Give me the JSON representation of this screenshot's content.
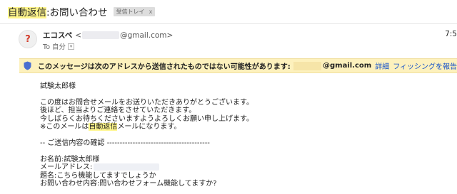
{
  "subject": {
    "highlight": "自動返信",
    "rest": ":お問い合わせ",
    "label": "受信トレイ",
    "label_close": "x"
  },
  "sender": {
    "avatar": "?",
    "name": "エコスペ",
    "lt": "<",
    "email": "@gmail.com>",
    "time": "7:5",
    "to": "To 自分",
    "to_caret": "▾"
  },
  "warning": {
    "text": "このメッセージは次のアドレスから送信されたものではない可能性があります:",
    "email": "@gmail.com",
    "details_link": "詳細",
    "report_link": "フィッシングを報告",
    "shield_color": "#4a6fd0"
  },
  "body": {
    "greeting": "試験太郎様",
    "line1": "この度はお問合せメールをお送りいただきありがとうございます。",
    "line2": "後ほど、担当よりご連絡をさせていただきます。",
    "line3": "今しばらくお待ちくださいますようよろしくお願い申し上げます。",
    "line4_pre": "※このメールは",
    "line4_hl": "自動返信",
    "line4_post": "メールになります。",
    "divider": "-- ご送信内容の確認 ----------------------------------------",
    "name_line": "お名前:試験太郎様",
    "email_line": "メールアドレス:",
    "subject_line": "題名:こちら機能してますでしょうか",
    "inquiry_line": "お問い合わせ内容:問い合わせフォーム機能してますか?"
  },
  "colors": {
    "highlight": "#fff68c",
    "warning_bg": "#fdf1bd",
    "link": "#1a55c9",
    "avatar_question": "#d23b2a"
  }
}
